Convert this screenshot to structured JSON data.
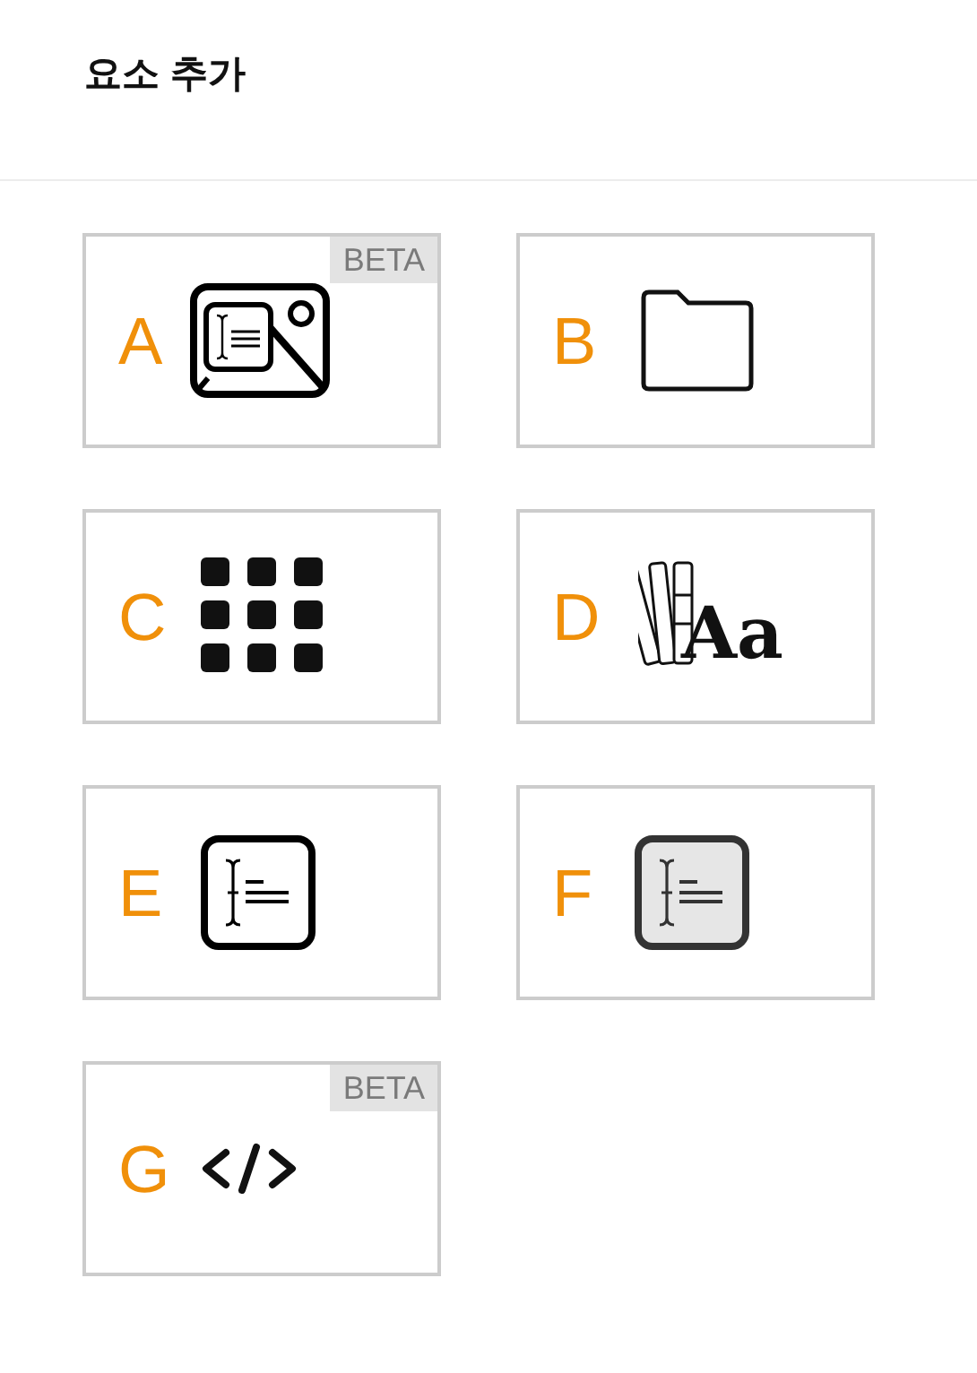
{
  "title": "요소 추가",
  "items": [
    {
      "letter": "A",
      "kind": "image-text",
      "badge": "BETA"
    },
    {
      "letter": "B",
      "kind": "folder"
    },
    {
      "letter": "C",
      "kind": "grid"
    },
    {
      "letter": "D",
      "kind": "fonts",
      "sample": "Aa"
    },
    {
      "letter": "E",
      "kind": "text-box"
    },
    {
      "letter": "F",
      "kind": "text-box-filled"
    },
    {
      "letter": "G",
      "kind": "code",
      "badge": "BETA"
    }
  ]
}
